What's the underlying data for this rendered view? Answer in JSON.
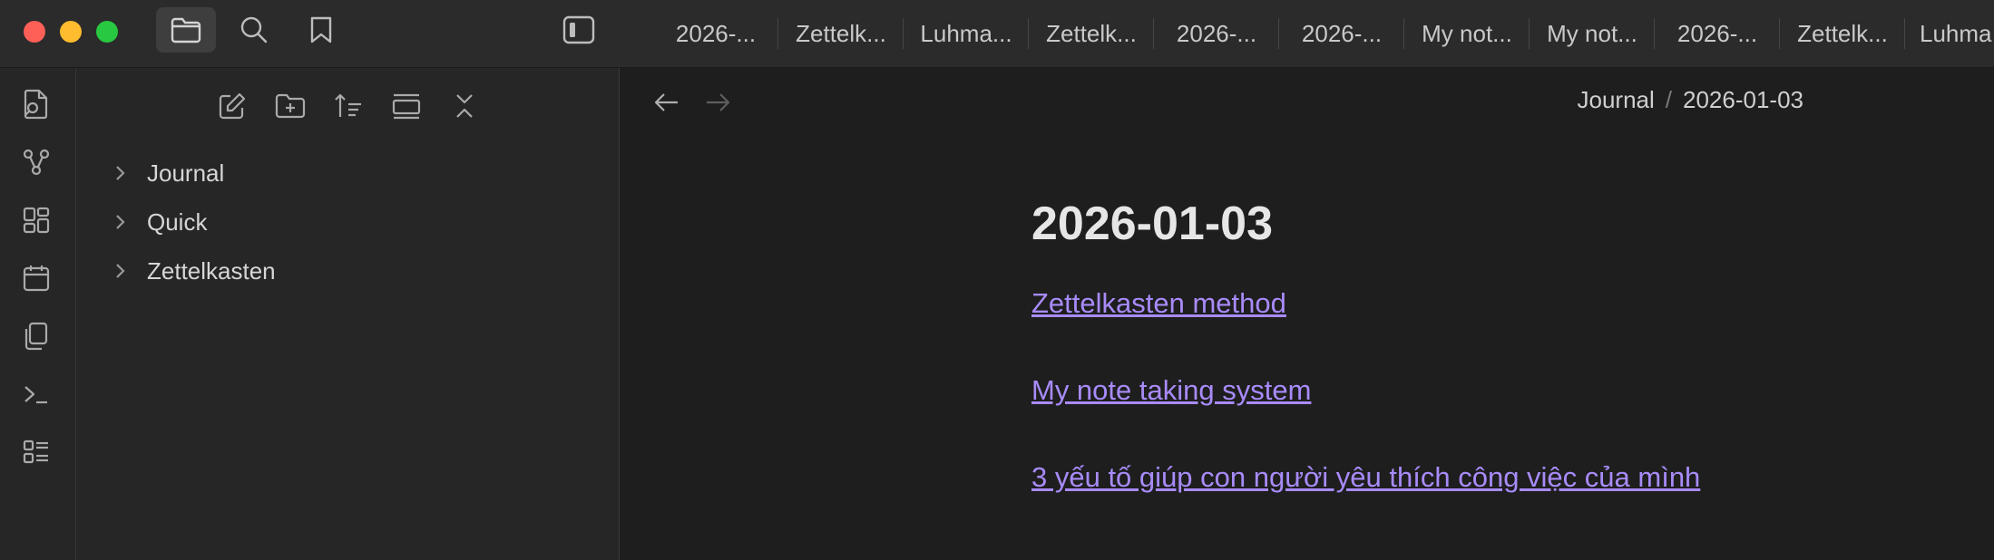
{
  "titlebar": {
    "traffic_lights": {
      "close_color": "#fe5f57",
      "minimize_color": "#febc2e",
      "maximize_color": "#28c840"
    },
    "tools": [
      {
        "icon": "folder-icon",
        "active": true
      },
      {
        "icon": "search-icon"
      },
      {
        "icon": "bookmark-icon"
      },
      {
        "icon": "sidebar-toggle-icon"
      }
    ],
    "tabs": [
      {
        "label": "2026-..."
      },
      {
        "label": "Zettelk..."
      },
      {
        "label": "Luhma..."
      },
      {
        "label": "Zettelk..."
      },
      {
        "label": "2026-..."
      },
      {
        "label": "2026-..."
      },
      {
        "label": "My not..."
      },
      {
        "label": "My not..."
      },
      {
        "label": "2026-..."
      },
      {
        "label": "Zettelk..."
      },
      {
        "label": "Luhma"
      }
    ]
  },
  "ribbon": {
    "icons": [
      "open-quick-switcher-icon",
      "graph-view-icon",
      "canvas-icon",
      "daily-note-calendar-icon",
      "templates-icon",
      "command-palette-icon",
      "bases-icon"
    ]
  },
  "sidebar": {
    "toolbar": [
      "new-note-icon",
      "new-folder-icon",
      "sort-icon",
      "auto-reveal-icon",
      "collapse-all-icon"
    ],
    "tree": [
      {
        "label": "Journal"
      },
      {
        "label": "Quick"
      },
      {
        "label": "Zettelkasten"
      }
    ]
  },
  "main": {
    "breadcrumb": {
      "folder": "Journal",
      "separator": "/",
      "note": "2026-01-03"
    },
    "note": {
      "title": "2026-01-03",
      "links": [
        {
          "text": "Zettelkasten method"
        },
        {
          "text": "My note taking system"
        },
        {
          "text": "3 yếu tố giúp con người yêu thích công việc của mình"
        }
      ]
    },
    "link_color": "#a88bfa"
  }
}
